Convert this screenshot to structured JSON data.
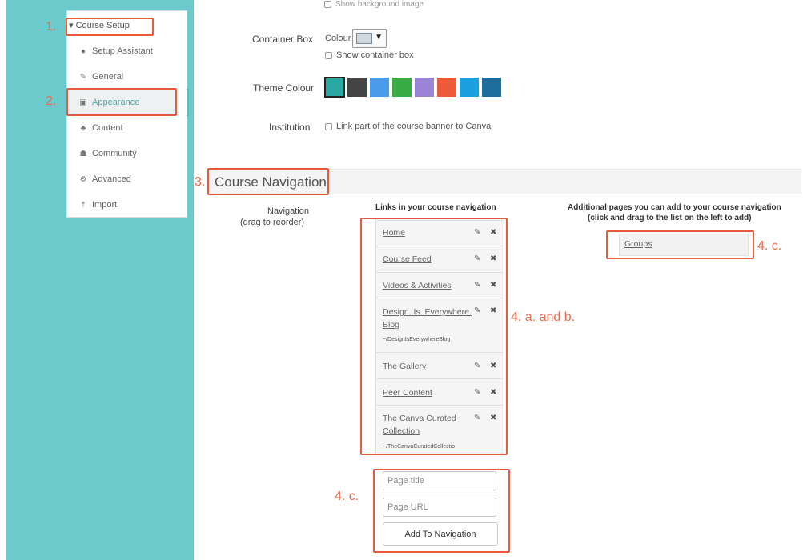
{
  "sidebar": {
    "course_setup": "▾ Course Setup",
    "items": [
      {
        "label": "Setup Assistant",
        "icon": "info-circle-icon"
      },
      {
        "label": "General",
        "icon": "edit-icon"
      },
      {
        "label": "Appearance",
        "icon": "image-icon"
      },
      {
        "label": "Content",
        "icon": "sitemap-icon"
      },
      {
        "label": "Community",
        "icon": "users-icon"
      },
      {
        "label": "Advanced",
        "icon": "cogs-icon"
      },
      {
        "label": "Import",
        "icon": "upload-icon"
      }
    ]
  },
  "annotations": {
    "a1": "1.",
    "a2": "2.",
    "a3": "3.",
    "a4ab": "4. a. and b.",
    "a4c_right": "4. c.",
    "a4c_bottom": "4. c."
  },
  "appearance": {
    "faded_top": "Show background image",
    "container_box_label": "Container Box",
    "colour_label": "Colour",
    "show_container_box": "Show container box",
    "theme_colour_label": "Theme Colour",
    "theme_colours": [
      "#2aa9a2",
      "#444444",
      "#4a9be8",
      "#3aaa45",
      "#9b83d6",
      "#ec5a3a",
      "#1aa0dc",
      "#1c6c9c"
    ],
    "institution_label": "Institution",
    "institution_option": "Link part of the course banner to Canva"
  },
  "course_navigation": {
    "title": "Course Navigation",
    "nav_label_1": "Navigation",
    "nav_label_2": "(drag to reorder)",
    "links_heading": "Links in your course navigation",
    "additional_heading_1": "Additional pages you can add to your course navigation",
    "additional_heading_2": "(click and drag to the list on the left to add)",
    "links": [
      {
        "line1": "Home"
      },
      {
        "line1": "Course Feed"
      },
      {
        "line1": "Videos & Activities"
      },
      {
        "line1": "Design. Is. Everywhere.",
        "line2": "Blog",
        "sub": "~/DesignIsEverywhereBlog"
      },
      {
        "line1": "The Gallery"
      },
      {
        "line1": "Peer Content"
      },
      {
        "line1": "The Canva Curated",
        "line2": "Collection",
        "sub": "~/TheCanvaCuratedCollectio"
      }
    ],
    "additional_pages": [
      "Groups"
    ],
    "page_title_placeholder": "Page title",
    "page_url_placeholder": "Page URL",
    "add_button": "Add To Navigation"
  }
}
